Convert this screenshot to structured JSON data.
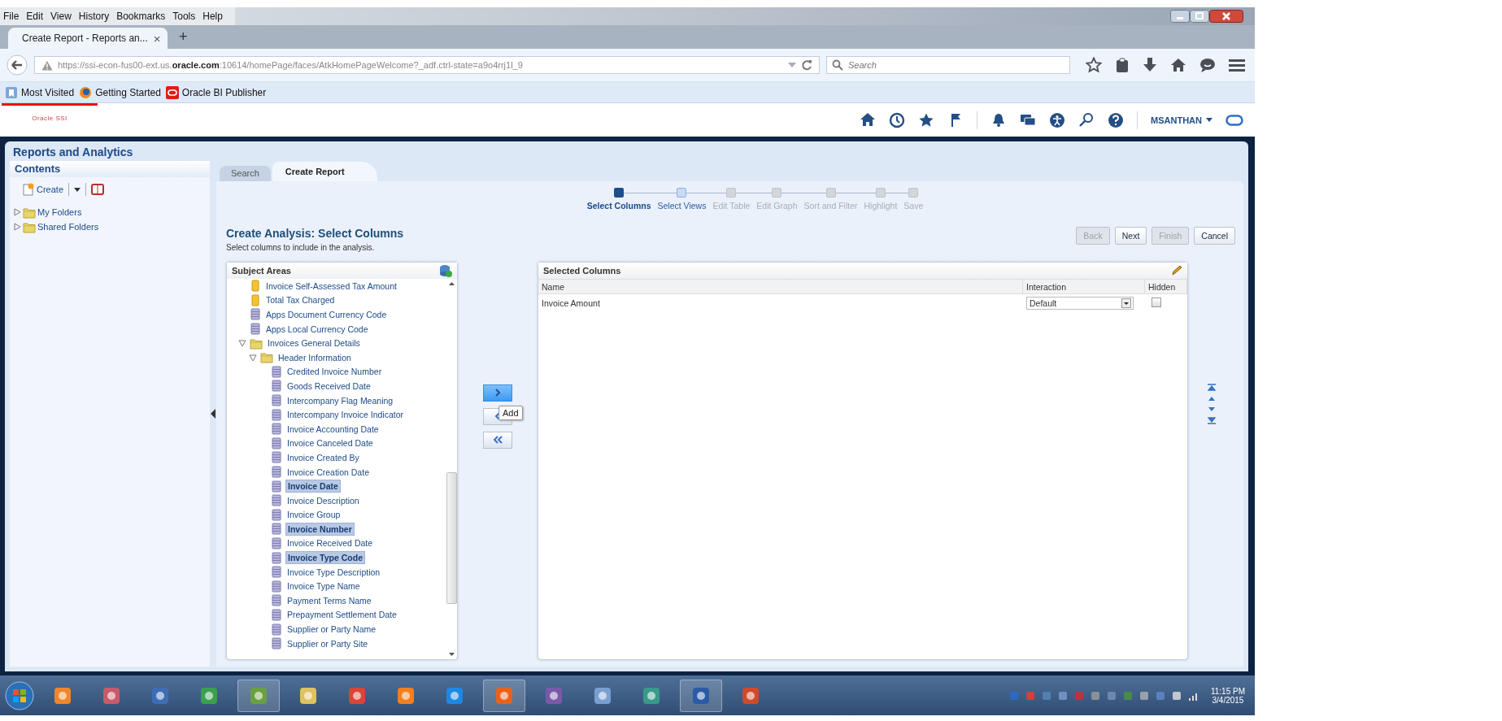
{
  "menu_bar": [
    "File",
    "Edit",
    "View",
    "History",
    "Bookmarks",
    "Tools",
    "Help"
  ],
  "browser_tab": {
    "title": "Create Report - Reports an...",
    "close": "×",
    "selected": true
  },
  "new_tab": "+",
  "address_bar": {
    "url": "https://ssi-econ-fus00-ext.us.**oracle.com**:10614/homePage/faces/AtkHomePageWelcome?_adf.ctrl-state=a9o4rrj1l_9"
  },
  "search_field": {
    "placeholder": "Search"
  },
  "bookmarks": [
    "Most Visited",
    "Getting Started",
    "Oracle BI Publisher"
  ],
  "app_header": {
    "logo": "Oracle SSI",
    "user": "MSANTHAN"
  },
  "page_title": "Reports and Analytics",
  "contents": {
    "title": "Contents",
    "create": "Create",
    "folders": [
      {
        "label": "My Folders",
        "expanded": false
      },
      {
        "label": "Shared Folders",
        "expanded": false
      }
    ]
  },
  "tabs": [
    {
      "label": "Search",
      "selected": false
    },
    {
      "label": "Create Report",
      "selected": true
    }
  ],
  "steps": [
    {
      "label": "Select Columns",
      "selected": true,
      "disabled": false
    },
    {
      "label": "Select Views",
      "selected": false,
      "disabled": false
    },
    {
      "label": "Edit Table",
      "selected": false,
      "disabled": true
    },
    {
      "label": "Edit Graph",
      "selected": false,
      "disabled": true
    },
    {
      "label": "Sort and Filter",
      "selected": false,
      "disabled": true
    },
    {
      "label": "Highlight",
      "selected": false,
      "disabled": true
    },
    {
      "label": "Save",
      "selected": false,
      "disabled": true
    }
  ],
  "heading": "Create Analysis: Select Columns",
  "instruction": "Select columns to include in the analysis.",
  "buttons": [
    {
      "label": "Back",
      "disabled": true
    },
    {
      "label": "Next",
      "disabled": false
    },
    {
      "label": "Finish",
      "disabled": true
    },
    {
      "label": "Cancel",
      "disabled": false
    }
  ],
  "subject_areas": {
    "title": "Subject Areas",
    "tree": [
      {
        "label": "Invoice Self-Assessed Tax Amount",
        "kind": "measure",
        "selected": false
      },
      {
        "label": "Total Tax Charged",
        "kind": "measure",
        "selected": false
      },
      {
        "label": "Apps Document Currency Code",
        "kind": "attribute",
        "selected": false
      },
      {
        "label": "Apps Local Currency Code",
        "kind": "attribute",
        "selected": false
      },
      {
        "label": "Invoices General Details",
        "kind": "folder",
        "expanded": true,
        "children": [
          {
            "label": "Header Information",
            "kind": "folder",
            "expanded": true,
            "children": [
              {
                "label": "Credited Invoice Number",
                "kind": "attribute",
                "selected": false
              },
              {
                "label": "Goods Received Date",
                "kind": "attribute",
                "selected": false
              },
              {
                "label": "Intercompany Flag Meaning",
                "kind": "attribute",
                "selected": false
              },
              {
                "label": "Intercompany Invoice Indicator",
                "kind": "attribute",
                "selected": false
              },
              {
                "label": "Invoice Accounting Date",
                "kind": "attribute",
                "selected": false
              },
              {
                "label": "Invoice Canceled Date",
                "kind": "attribute",
                "selected": false
              },
              {
                "label": "Invoice Created By",
                "kind": "attribute",
                "selected": false
              },
              {
                "label": "Invoice Creation Date",
                "kind": "attribute",
                "selected": false
              },
              {
                "label": "Invoice Date",
                "kind": "attribute",
                "selected": true
              },
              {
                "label": "Invoice Description",
                "kind": "attribute",
                "selected": false
              },
              {
                "label": "Invoice Group",
                "kind": "attribute",
                "selected": false
              },
              {
                "label": "Invoice Number",
                "kind": "attribute",
                "selected": true
              },
              {
                "label": "Invoice Received Date",
                "kind": "attribute",
                "selected": false
              },
              {
                "label": "Invoice Type Code",
                "kind": "attribute",
                "selected": true
              },
              {
                "label": "Invoice Type Description",
                "kind": "attribute",
                "selected": false
              },
              {
                "label": "Invoice Type Name",
                "kind": "attribute",
                "selected": false
              },
              {
                "label": "Payment Terms Name",
                "kind": "attribute",
                "selected": false
              },
              {
                "label": "Prepayment Settlement Date",
                "kind": "attribute",
                "selected": false
              },
              {
                "label": "Supplier or Party Name",
                "kind": "attribute",
                "selected": false
              },
              {
                "label": "Supplier or Party Site",
                "kind": "attribute",
                "selected": false
              }
            ]
          }
        ]
      }
    ]
  },
  "shuttle": {
    "tooltip": "Add"
  },
  "selected_columns": {
    "title": "Selected Columns",
    "columns": [
      "Name",
      "Interaction",
      "Hidden"
    ],
    "rows": [
      {
        "name": "Invoice Amount",
        "interaction": "Default",
        "hidden": false
      }
    ]
  },
  "taskbar": {
    "time": "11:15 PM",
    "date": "3/4/2015"
  }
}
